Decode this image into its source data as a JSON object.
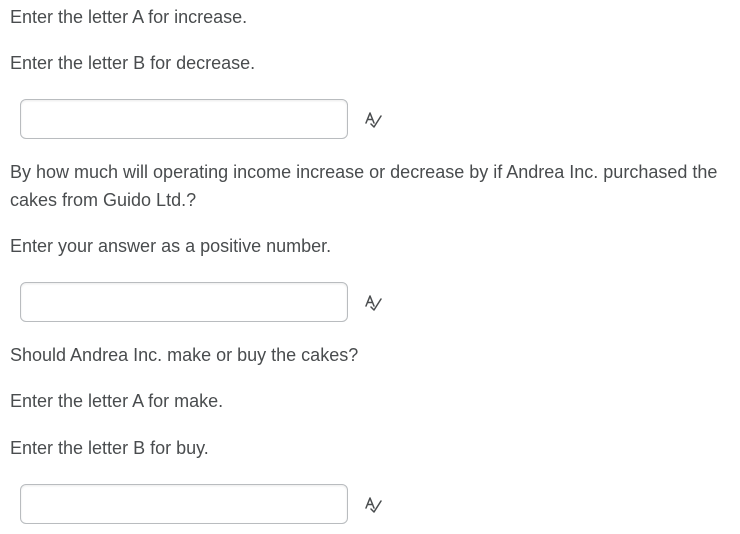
{
  "question_part_1": {
    "instruction_a": "Enter the letter A for increase.",
    "instruction_b": "Enter the letter B for decrease.",
    "answer_value": "",
    "spellcheck_icon": "spellcheck-icon"
  },
  "question_part_2": {
    "prompt": "By how much will operating income increase or decrease by if Andrea Inc. purchased the cakes from Guido Ltd.?",
    "instruction": "Enter your answer as a positive number.",
    "answer_value": "",
    "spellcheck_icon": "spellcheck-icon"
  },
  "question_part_3": {
    "prompt": "Should Andrea Inc. make or buy the cakes?",
    "instruction_a": "Enter the letter A for make.",
    "instruction_b": "Enter the letter B for buy.",
    "answer_value": "",
    "spellcheck_icon": "spellcheck-icon"
  }
}
